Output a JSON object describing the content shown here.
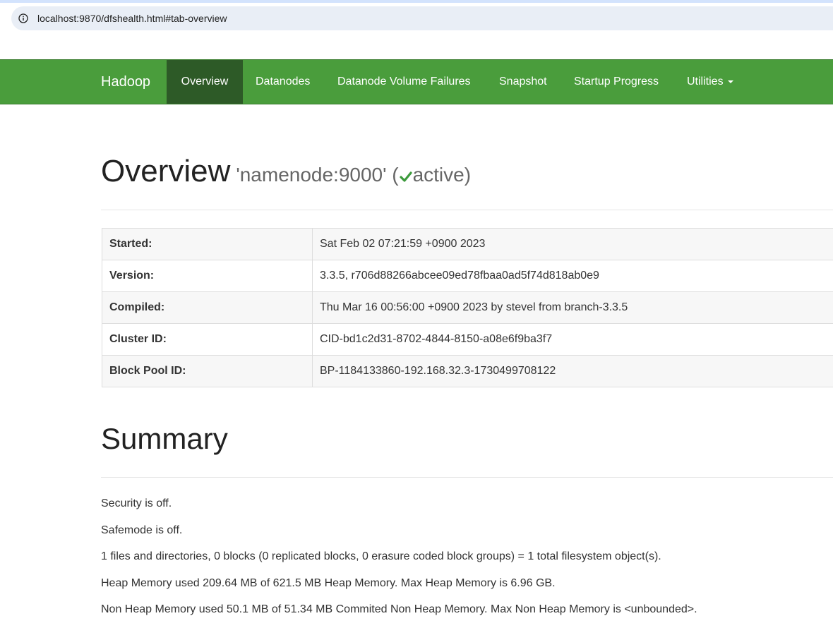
{
  "browser": {
    "url": "localhost:9870/dfshealth.html#tab-overview"
  },
  "navbar": {
    "brand": "Hadoop",
    "items": [
      {
        "label": "Overview",
        "active": true
      },
      {
        "label": "Datanodes",
        "active": false
      },
      {
        "label": "Datanode Volume Failures",
        "active": false
      },
      {
        "label": "Snapshot",
        "active": false
      },
      {
        "label": "Startup Progress",
        "active": false
      },
      {
        "label": "Utilities",
        "active": false,
        "dropdown": true
      }
    ],
    "colors": {
      "bar": "#4a9d3c",
      "active": "#2d5a27"
    }
  },
  "overview": {
    "title": "Overview",
    "node_prefix": "'namenode:9000' (",
    "status": "active",
    "node_suffix": ")",
    "status_icon": "check-icon",
    "status_color": "#3c9a3c"
  },
  "info_table": [
    {
      "key": "Started:",
      "value": "Sat Feb 02 07:21:59 +0900 2023"
    },
    {
      "key": "Version:",
      "value": "3.3.5, r706d88266abcee09ed78fbaa0ad5f74d818ab0e9"
    },
    {
      "key": "Compiled:",
      "value": "Thu Mar 16 00:56:00 +0900 2023 by stevel from branch-3.3.5"
    },
    {
      "key": "Cluster ID:",
      "value": "CID-bd1c2d31-8702-4844-8150-a08e6f9ba3f7"
    },
    {
      "key": "Block Pool ID:",
      "value": "BP-1184133860-192.168.32.3-1730499708122"
    }
  ],
  "summary": {
    "title": "Summary",
    "lines": [
      "Security is off.",
      "Safemode is off.",
      "1 files and directories, 0 blocks (0 replicated blocks, 0 erasure coded block groups) = 1 total filesystem object(s).",
      "Heap Memory used 209.64 MB of 621.5 MB Heap Memory. Max Heap Memory is 6.96 GB.",
      "Non Heap Memory used 50.1 MB of 51.34 MB Commited Non Heap Memory. Max Non Heap Memory is <unbounded>."
    ]
  }
}
